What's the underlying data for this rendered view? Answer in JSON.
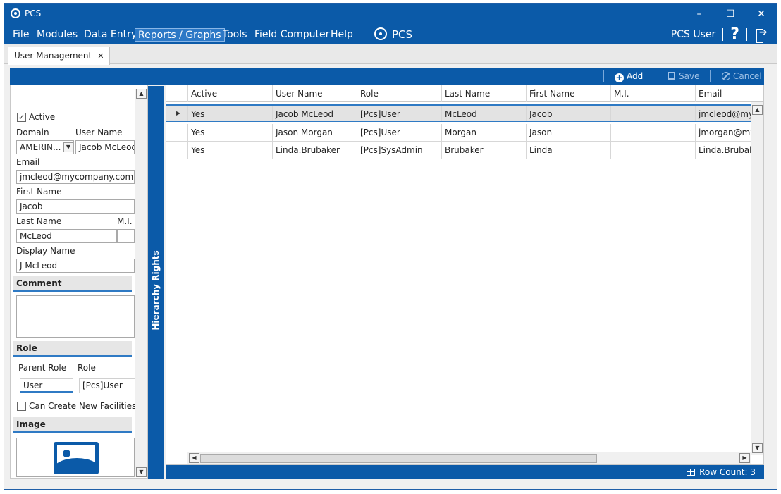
{
  "window": {
    "title": "PCS",
    "min": "–",
    "max": "☐",
    "close": "✕"
  },
  "menu": {
    "items": [
      "File",
      "Modules",
      "Data Entry",
      "Reports / Graphs",
      "Tools",
      "Field Computer",
      "Help"
    ],
    "brand": "PCS",
    "user": "PCS User",
    "help": "?"
  },
  "tabs": [
    {
      "label": "User Management",
      "close": "✕"
    }
  ],
  "toolbar": {
    "add": "Add",
    "save": "Save",
    "cancel": "Cancel"
  },
  "form": {
    "active_label": "Active",
    "active_checked": "✓",
    "domain_label": "Domain",
    "username_label": "User Name",
    "domain_value": "AMERIN...",
    "username_value": "Jacob McLeod",
    "email_label": "Email",
    "email_value": "jmcleod@mycompany.com",
    "first_label": "First Name",
    "first_value": "Jacob",
    "last_label": "Last Name",
    "mi_label": "M.I.",
    "last_value": "McLeod",
    "mi_value": "",
    "display_label": "Display Name",
    "display_value": "J McLeod",
    "comment_header": "Comment",
    "comment_value": "",
    "role_header": "Role",
    "parent_role_label": "Parent Role",
    "role_label": "Role",
    "parent_role_value": "User",
    "role_value": "[Pcs]User",
    "can_create_label": "Can Create New Facilities On",
    "image_header": "Image"
  },
  "hierarchy_label": "Hierarchy Rights",
  "grid": {
    "columns": [
      "Active",
      "User Name",
      "Role",
      "Last Name",
      "First Name",
      "M.I.",
      "Email"
    ],
    "rows": [
      [
        "Yes",
        "Jacob McLeod",
        "[Pcs]User",
        "McLeod",
        "Jacob",
        "",
        "jmcleod@myco"
      ],
      [
        "Yes",
        "Jason Morgan",
        "[Pcs]User",
        "Morgan",
        "Jason",
        "",
        "jmorgan@myco"
      ],
      [
        "Yes",
        "Linda.Brubaker",
        "[Pcs]SysAdmin",
        "Brubaker",
        "Linda",
        "",
        "Linda.Brubaker"
      ]
    ]
  },
  "status": {
    "row_count": "Row Count: 3"
  }
}
